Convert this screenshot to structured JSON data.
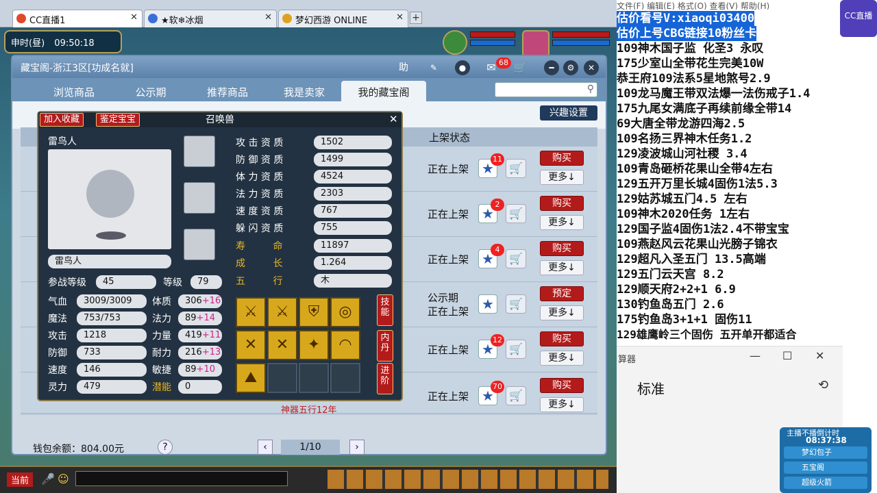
{
  "browser": {
    "tabs": [
      {
        "label": "CC直播1",
        "active": true
      },
      {
        "label": "★软❄冰烟",
        "active": false
      },
      {
        "label": "梦幻西游 ONLINE",
        "active": false
      }
    ],
    "new_tab": "+"
  },
  "hud": {
    "time": "申时(昼)",
    "clock": "09:50:18"
  },
  "cbg": {
    "title": "藏宝阁-浙江3区[功成名就]",
    "help": "助",
    "msg_badge": "68",
    "tabs": [
      "浏览商品",
      "公示期",
      "推荐商品",
      "我是卖家",
      "我的藏宝阁"
    ],
    "interest_button": "兴趣设置",
    "column_status": "上架状态",
    "rows": [
      {
        "status": "正在上架",
        "status2": "",
        "badge": "11",
        "action": "购买",
        "more": "更多↓"
      },
      {
        "status": "正在上架",
        "status2": "",
        "badge": "2",
        "action": "购买",
        "more": "更多↓"
      },
      {
        "status": "正在上架",
        "status2": "",
        "badge": "4",
        "action": "购买",
        "more": "更多↓"
      },
      {
        "status": "公示期",
        "status2": "正在上架",
        "badge": "",
        "action": "预定",
        "more": "更多↓"
      },
      {
        "status": "正在上架",
        "status2": "",
        "badge": "12",
        "action": "购买",
        "more": "更多↓"
      },
      {
        "status": "正在上架",
        "status2": "",
        "badge": "70",
        "action": "购买",
        "more": "更多↓"
      }
    ],
    "wallet": "钱包余额：804.00元",
    "help_q": "?",
    "page": "1/10"
  },
  "pet": {
    "title": "召唤兽",
    "btn_collect": "加入收藏",
    "btn_identify": "鉴定宝宝",
    "name": "雷鸟人",
    "name2": "雷鸟人",
    "qualities": [
      {
        "label": "攻 击 资 质",
        "value": "1502"
      },
      {
        "label": "防 御 资 质",
        "value": "1499"
      },
      {
        "label": "体 力 资 质",
        "value": "4524"
      },
      {
        "label": "法 力 资 质",
        "value": "2303"
      },
      {
        "label": "速 度 资 质",
        "value": "767"
      },
      {
        "label": "躲 闪 资 质",
        "value": "755"
      }
    ],
    "life_label": "寿 命",
    "life": "11897",
    "growth_label": "成 长",
    "growth": "1.264",
    "element_label": "五 行",
    "element": "木",
    "battle_level_label": "参战等级",
    "battle_level": "45",
    "level_label": "等级",
    "level": "79",
    "stats_left": [
      {
        "label": "气血",
        "value": "3009/3009"
      },
      {
        "label": "魔法",
        "value": "753/753"
      },
      {
        "label": "攻击",
        "value": "1218"
      },
      {
        "label": "防御",
        "value": "733"
      },
      {
        "label": "速度",
        "value": "146"
      },
      {
        "label": "灵力",
        "value": "479"
      }
    ],
    "stats_right": [
      {
        "label": "体质",
        "base": "306",
        "bonus": "+16"
      },
      {
        "label": "法力",
        "base": "89",
        "bonus": "+14"
      },
      {
        "label": "力量",
        "base": "419",
        "bonus": "+11"
      },
      {
        "label": "耐力",
        "base": "216",
        "bonus": "+13"
      },
      {
        "label": "敏捷",
        "base": "89",
        "bonus": "+10"
      },
      {
        "label": "潜能",
        "base": "0",
        "bonus": ""
      }
    ],
    "vtabs": [
      "技能",
      "内丹",
      "进阶"
    ],
    "footer_text": "神器五行12年"
  },
  "right_panel": {
    "menu": "文件(F)  编辑(E)  格式(O)  查看(V)  帮助(H)",
    "lines": [
      "估价看号V:xiaoqi03400",
      "估价上号CBG链接10粉丝卡",
      "109神木国子监 化圣3 永叹",
      "175少室山全带花生完美10W",
      "恭王府109法系5星地煞号2.9",
      "109龙马魔王带双法爆一法伤戒子1.4",
      "175九尾女满底子再续前缘全带14",
      "69大唐全带龙游四海2.5",
      "109名扬三界神木任务1.2",
      "129凌波城山河社稷  3.4",
      "109青岛砸桥花果山全带4左右",
      "129五开万里长城4固伤1法5.3",
      "129姑苏城五门4.5 左右",
      "109神木2020任务  1左右",
      "129国子监4固伤1法2.4不带宝宝",
      "109燕赵风云花果山光膀子锦衣",
      "129超凡入圣五门  13.5高端",
      "129五门云天宫 8.2",
      "129顺天府2+2+1  6.9",
      "130钓鱼岛五门  2.6",
      "175钓鱼岛3+1+1 固伤11",
      "129雄鹰岭三个固伤 五开单开都适合"
    ],
    "cc_logo": "CC直播",
    "calc_title": "算器",
    "calc_mode": "标准",
    "live_title": "主播不播倒计时",
    "live_time": "08:37:38",
    "live_items": [
      "梦幻包子",
      "五宝阁",
      "超级火箭"
    ]
  },
  "bottom": {
    "current": "当前"
  }
}
